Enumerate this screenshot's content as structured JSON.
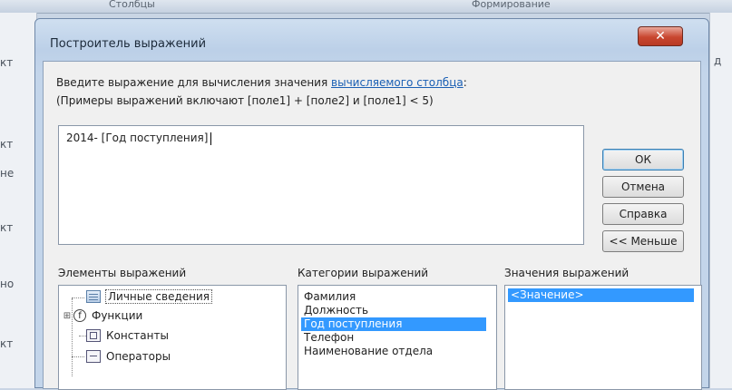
{
  "background": {
    "tabs": [
      "Столбцы",
      "Формирование"
    ],
    "side_items": [
      "кт",
      "кт",
      "не",
      "кт",
      "но",
      "кт"
    ],
    "right_text": "д"
  },
  "dialog": {
    "title": "Построитель выражений",
    "close_symbol": "✕",
    "description_prefix": "Введите выражение для вычисления значения ",
    "description_link": "вычисляемого столбца",
    "description_suffix": ":",
    "examples": "(Примеры выражений включают [поле1] + [поле2] и [поле1] < 5)",
    "expression_value": "2014- [Год поступления]",
    "buttons": {
      "ok": "ОК",
      "cancel": "Отмена",
      "help": "Справка",
      "less": "<< Меньше"
    },
    "elements_label": "Элементы выражений",
    "categories_label": "Категории выражений",
    "values_label": "Значения выражений",
    "tree": [
      {
        "label": "Личные сведения",
        "icon": "form-icon",
        "expander": ""
      },
      {
        "label": "Функции",
        "icon": "function-icon",
        "expander": "⊞"
      },
      {
        "label": "Константы",
        "icon": "constants-icon",
        "expander": ""
      },
      {
        "label": "Операторы",
        "icon": "operators-icon",
        "expander": ""
      }
    ],
    "categories": [
      "Фамилия",
      "Должность",
      "Год поступления",
      "Телефон",
      "Наименование отдела"
    ],
    "selected_category_index": 2,
    "values": [
      "<Значение>"
    ]
  }
}
